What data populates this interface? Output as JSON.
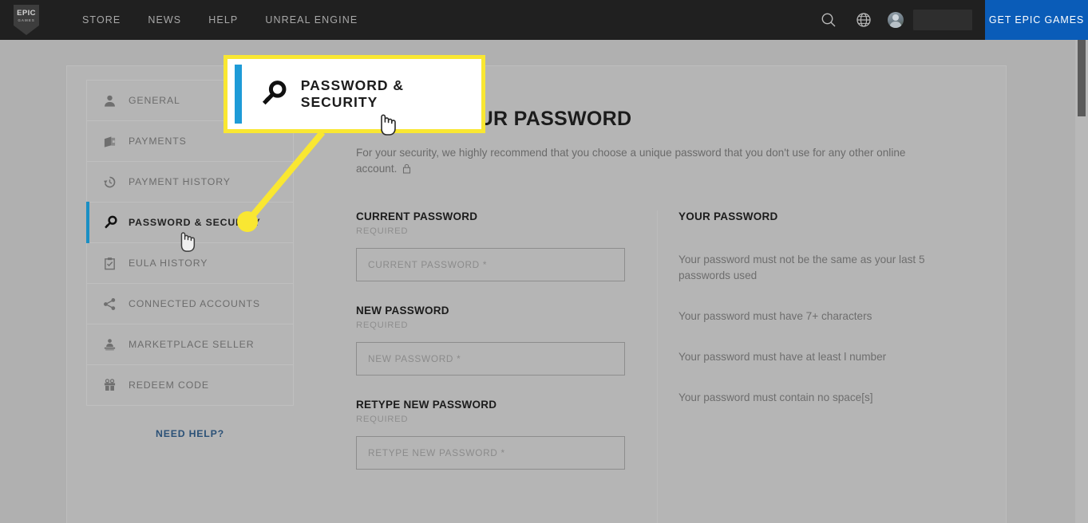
{
  "nav": {
    "logo": {
      "top": "EPIC",
      "bottom": "GAMES",
      "icon": "epic-games-logo"
    },
    "links": [
      "STORE",
      "NEWS",
      "HELP",
      "UNREAL ENGINE"
    ],
    "icons": [
      "search-icon",
      "globe-icon"
    ],
    "username": "",
    "cta": "GET EPIC GAMES",
    "cta_color": "#0a5cb8"
  },
  "sidebar": {
    "items": [
      {
        "label": "GENERAL",
        "icon": "person-icon",
        "active": false
      },
      {
        "label": "PAYMENTS",
        "icon": "wallet-icon",
        "active": false
      },
      {
        "label": "PAYMENT HISTORY",
        "icon": "history-icon",
        "active": false
      },
      {
        "label": "PASSWORD & SECURITY",
        "icon": "key-icon",
        "active": true
      },
      {
        "label": "EULA HISTORY",
        "icon": "clipboard-check-icon",
        "active": false
      },
      {
        "label": "CONNECTED ACCOUNTS",
        "icon": "share-icon",
        "active": false
      },
      {
        "label": "MARKETPLACE SELLER",
        "icon": "seller-icon",
        "active": false
      },
      {
        "label": "REDEEM CODE",
        "icon": "gift-icon",
        "active": false
      }
    ],
    "need_help": "NEED HELP?",
    "active_accent_color": "#1a8fc4",
    "link_color": "#2b5177"
  },
  "main": {
    "title": "CHANGE YOUR PASSWORD",
    "description": "For your security, we highly recommend that you choose a unique password that you don't use for any other online account.",
    "description_icon": "lock-icon",
    "fields": [
      {
        "label": "CURRENT PASSWORD",
        "required": "REQUIRED",
        "placeholder": "CURRENT PASSWORD *",
        "value": ""
      },
      {
        "label": "NEW PASSWORD",
        "required": "REQUIRED",
        "placeholder": "NEW PASSWORD *",
        "value": ""
      },
      {
        "label": "RETYPE NEW PASSWORD",
        "required": "REQUIRED",
        "placeholder": "RETYPE NEW PASSWORD *",
        "value": ""
      }
    ],
    "requirements": {
      "heading": "YOUR PASSWORD",
      "rules": [
        "Your password must not be the same as your last 5 passwords used",
        "Your password must have 7+ characters",
        "Your password must have at least l number",
        "Your password must contain no space[s]"
      ]
    }
  },
  "callout": {
    "text": "PASSWORD & SECURITY",
    "icon": "key-icon",
    "border_color": "#f9e732",
    "accent_color": "#1e9bd7",
    "background": "#ffffff"
  }
}
